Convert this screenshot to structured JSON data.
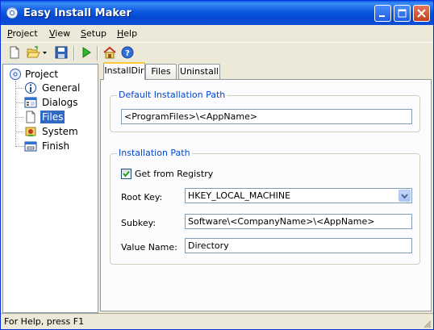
{
  "window": {
    "title": "Easy Install Maker",
    "controls": {
      "minimize": "minimize-icon",
      "maximize": "maximize-icon",
      "close": "close-icon"
    }
  },
  "menu": {
    "items": [
      {
        "label": "Project",
        "accel": "P",
        "rest": "roject"
      },
      {
        "label": "View",
        "accel": "V",
        "rest": "iew"
      },
      {
        "label": "Setup",
        "accel": "S",
        "rest": "etup"
      },
      {
        "label": "Help",
        "accel": "H",
        "rest": "elp"
      }
    ]
  },
  "toolbar": {
    "tools": [
      "new-file-icon",
      "open-folder-icon",
      "dropdown-arrow-icon",
      "save-icon",
      "run-icon",
      "home-icon",
      "help-icon"
    ]
  },
  "tree": {
    "root": "Project",
    "items": [
      {
        "label": "General",
        "icon": "info-icon"
      },
      {
        "label": "Dialogs",
        "icon": "dialogs-icon"
      },
      {
        "label": "Files",
        "icon": "file-icon",
        "selected": true
      },
      {
        "label": "System",
        "icon": "system-icon"
      },
      {
        "label": "Finish",
        "icon": "finish-icon"
      }
    ]
  },
  "tabs": [
    {
      "label": "InstallDir",
      "active": true
    },
    {
      "label": "Files",
      "active": false
    },
    {
      "label": "Uninstall",
      "active": false
    }
  ],
  "default_path": {
    "group_title": "Default Installation Path",
    "value": "<ProgramFiles>\\<AppName>"
  },
  "install_path": {
    "group_title": "Installation Path",
    "checkbox_label": "Get from Registry",
    "checkbox_checked": true,
    "root_key_label": "Root Key:",
    "root_key_value": "HKEY_LOCAL_MACHINE",
    "subkey_label": "Subkey:",
    "subkey_value": "Software\\<CompanyName>\\<AppName>",
    "value_name_label": "Value Name:",
    "value_name_value": "Directory"
  },
  "status": {
    "text": "For Help, press F1"
  },
  "colors": {
    "titlebar": "#0b58e0",
    "selection": "#316ac5",
    "group_title": "#0046d5",
    "tab_highlight": "#ffc83c"
  }
}
